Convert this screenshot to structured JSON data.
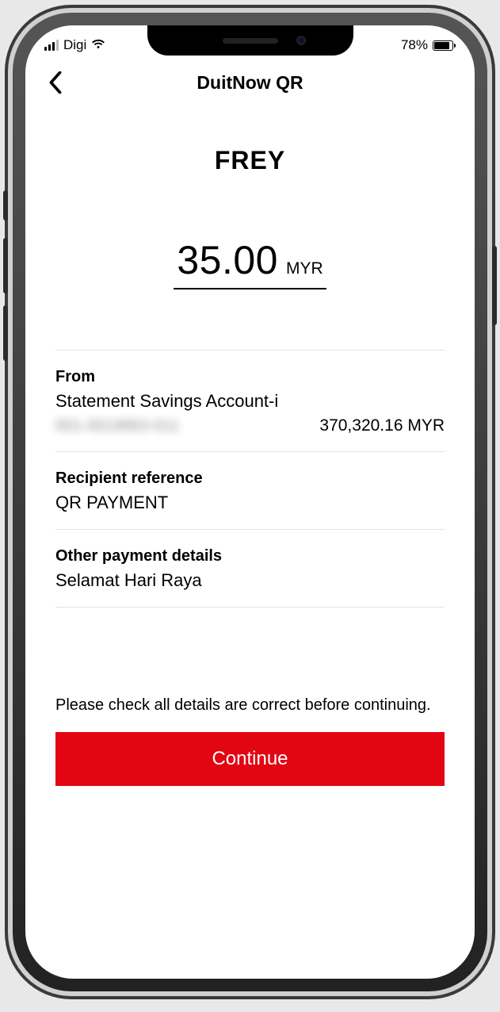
{
  "status": {
    "carrier": "Digi",
    "battery_pct": "78%"
  },
  "nav": {
    "title": "DuitNow QR"
  },
  "merchant": "FREY",
  "amount": {
    "value": "35.00",
    "currency": "MYR"
  },
  "from": {
    "label": "From",
    "account_name": "Statement Savings Account-i",
    "account_number_masked": "001-0019863-011",
    "balance": "370,320.16 MYR"
  },
  "reference": {
    "label": "Recipient reference",
    "value": "QR PAYMENT"
  },
  "details": {
    "label": "Other payment details",
    "value": "Selamat Hari Raya"
  },
  "notice": "Please check all details are correct before continuing.",
  "cta": "Continue"
}
